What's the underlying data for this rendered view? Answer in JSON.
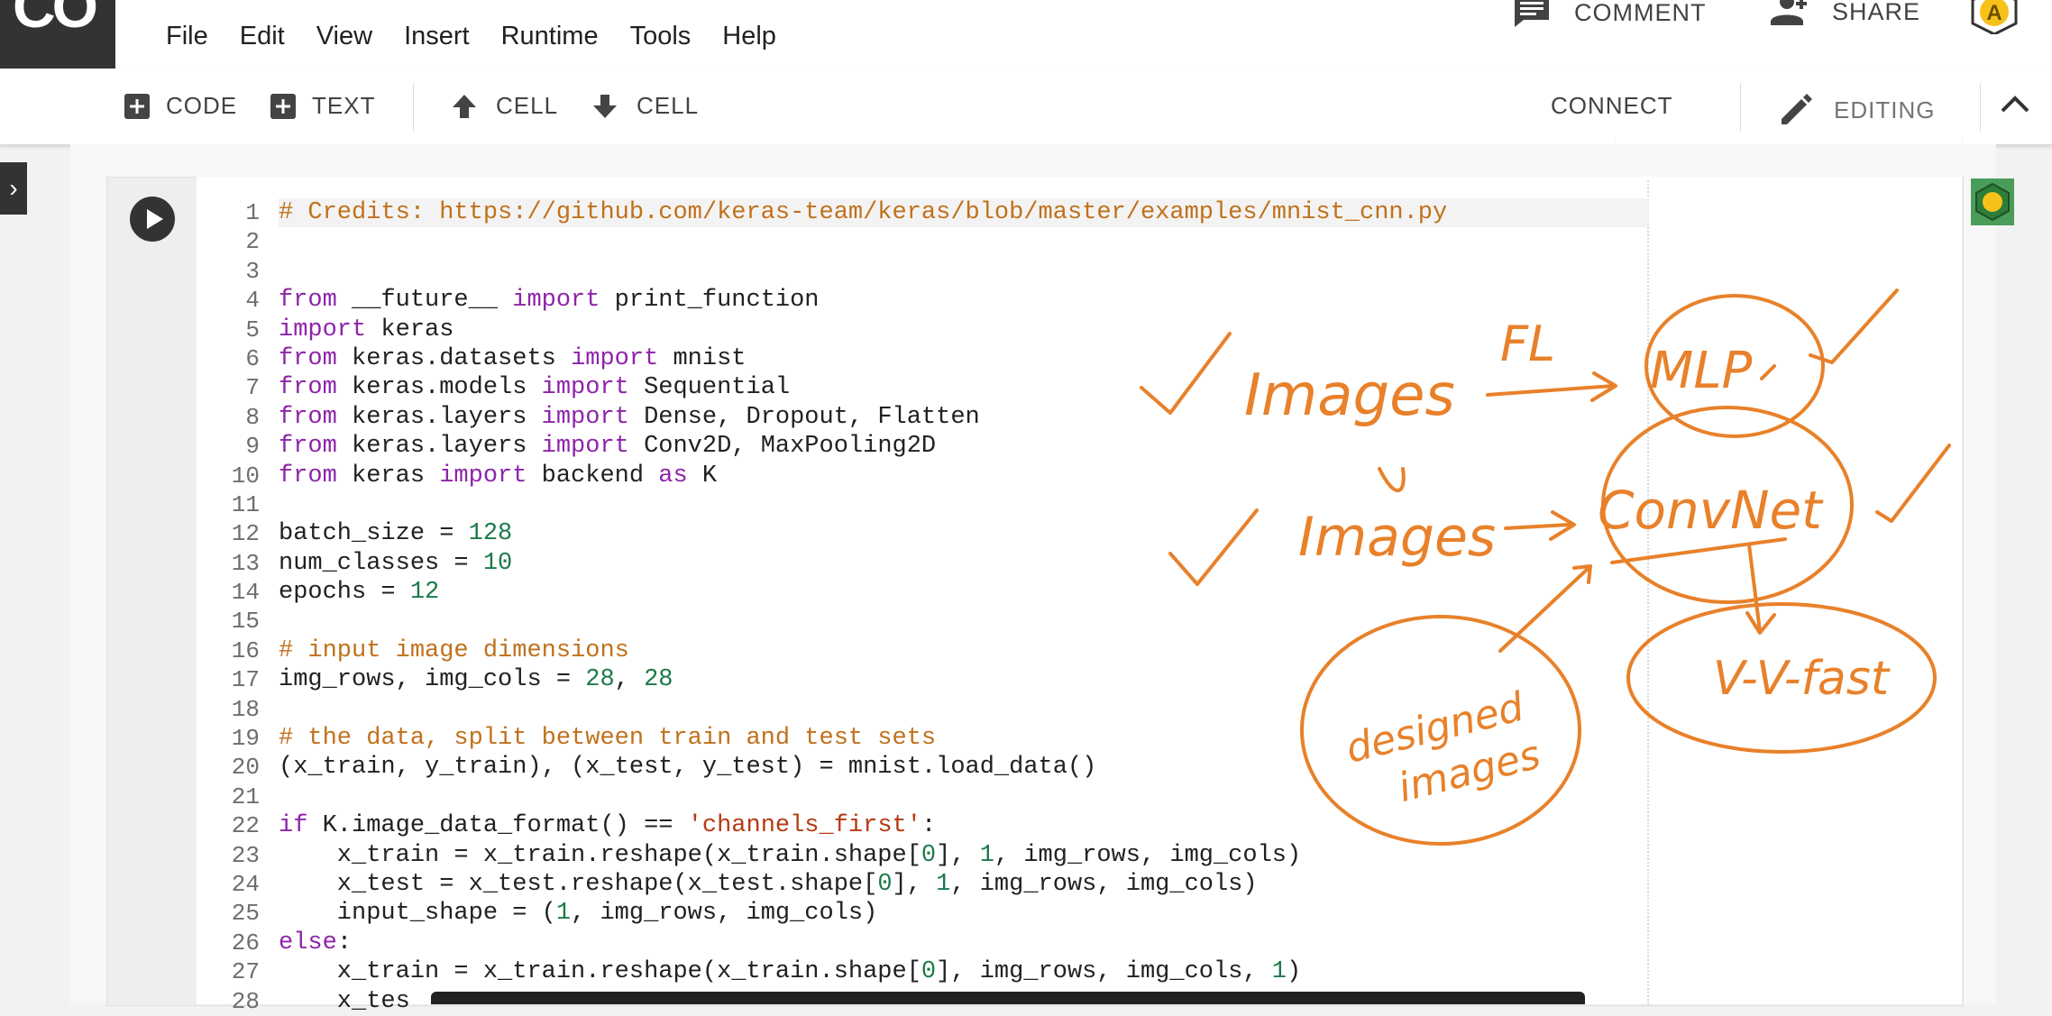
{
  "app": {
    "logo_text": "CO"
  },
  "menu": [
    "File",
    "Edit",
    "View",
    "Insert",
    "Runtime",
    "Tools",
    "Help"
  ],
  "header_actions": {
    "comment_label": "COMMENT",
    "share_label": "SHARE",
    "avatar_text": "A"
  },
  "toolbar": {
    "add_code_label": "CODE",
    "add_text_label": "TEXT",
    "move_up_label": "CELL",
    "move_down_label": "CELL",
    "connect_label": "CONNECT",
    "editing_label": "EDITING"
  },
  "cell": {
    "line_numbers": [
      "1",
      "2",
      "3",
      "4",
      "5",
      "6",
      "7",
      "8",
      "9",
      "10",
      "11",
      "12",
      "13",
      "14",
      "15",
      "16",
      "17",
      "18",
      "19",
      "20",
      "21",
      "22",
      "23",
      "24",
      "25",
      "26",
      "27",
      "28"
    ],
    "code_lines": [
      "# Credits: https://github.com/keras-team/keras/blob/master/examples/mnist_cnn.py",
      "",
      "",
      "from __future__ import print_function",
      "import keras",
      "from keras.datasets import mnist",
      "from keras.models import Sequential",
      "from keras.layers import Dense, Dropout, Flatten",
      "from keras.layers import Conv2D, MaxPooling2D",
      "from keras import backend as K",
      "",
      "batch_size = 128",
      "num_classes = 10",
      "epochs = 12",
      "",
      "# input image dimensions",
      "img_rows, img_cols = 28, 28",
      "",
      "# the data, split between train and test sets",
      "(x_train, y_train), (x_test, y_test) = mnist.load_data()",
      "",
      "if K.image_data_format() == 'channels_first':",
      "    x_train = x_train.reshape(x_train.shape[0], 1, img_rows, img_cols)",
      "    x_test = x_test.reshape(x_test.shape[0], 1, img_rows, img_cols)",
      "    input_shape = (1, img_rows, img_cols)",
      "else:",
      "    x_train = x_train.reshape(x_train.shape[0], img_rows, img_cols, 1)",
      "    x_tes"
    ]
  },
  "annotations": {
    "pen_color": "#e8812a",
    "words": [
      "Images",
      "FL",
      "MLP",
      "Images",
      "ConvNet",
      "V-V-fast",
      "designed images"
    ]
  },
  "colors": {
    "keyword": "#8e24aa",
    "comment": "#c0711b",
    "string": "#b63a12",
    "number": "#1b7a4a",
    "logo_bg": "#333333"
  }
}
